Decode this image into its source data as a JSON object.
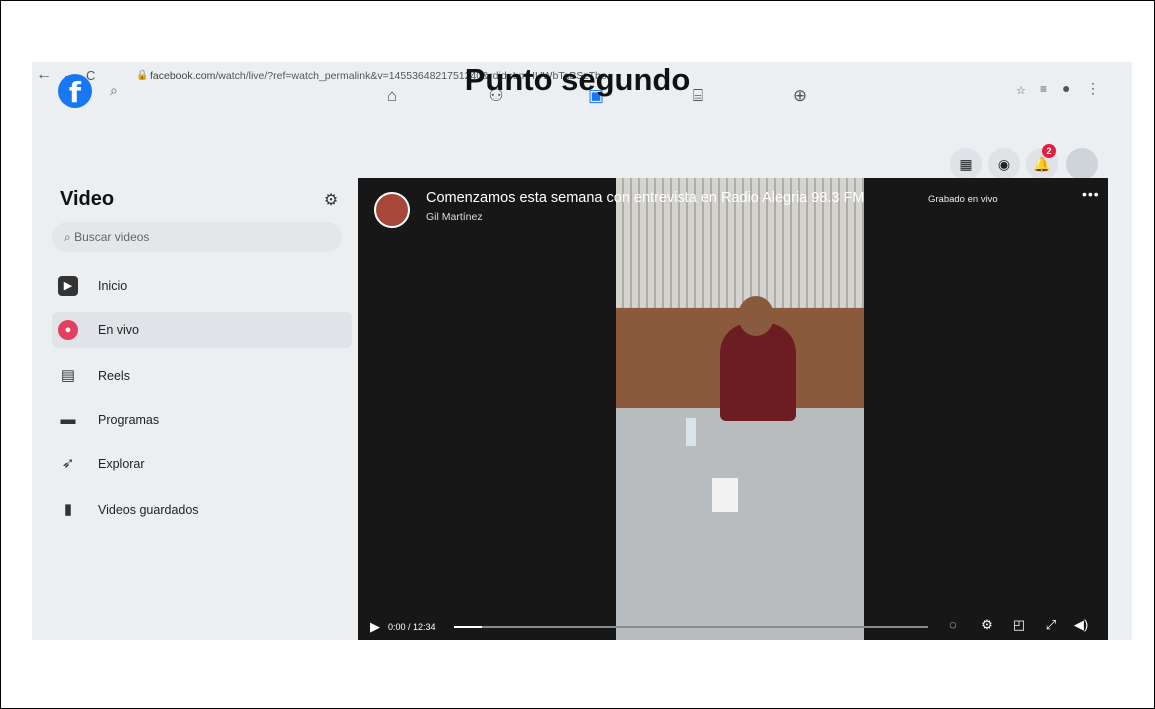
{
  "doc": {
    "title": "Punto segundo"
  },
  "browser": {
    "url_host": "facebook.com",
    "url_path": "/watch/live/?ref=watch_permalink&v=1455364821751240&rdid=LmHUWbTaBSzTbo",
    "back": "←",
    "forward": "→",
    "reload": "C"
  },
  "fb": {
    "logo": "f",
    "nav_tabs": [
      {
        "icon": "home-icon",
        "glyph": "⌂"
      },
      {
        "icon": "friends-icon",
        "glyph": "👥"
      },
      {
        "icon": "watch-icon",
        "glyph": "▶"
      },
      {
        "icon": "marketplace-icon",
        "glyph": "🏪"
      },
      {
        "icon": "gaming-icon",
        "glyph": "🎮"
      }
    ],
    "notification_count": "2"
  },
  "sidebar": {
    "title": "Video",
    "search_placeholder": "Buscar videos",
    "items": [
      {
        "label": "Inicio"
      },
      {
        "label": "En vivo"
      },
      {
        "label": "Reels"
      },
      {
        "label": "Programas"
      },
      {
        "label": "Explorar"
      },
      {
        "label": "Videos guardados"
      }
    ]
  },
  "video": {
    "title": "Comenzamos esta semana con entrevista en Radio Alegria 98.3 FM",
    "tag": "Grabado en vivo",
    "author": "Gil Martínez",
    "time": "0:00 / 12:34",
    "progress": 0.06
  },
  "colors": {
    "accent": "#1877f2",
    "live": "#e4405f",
    "badge": "#e41e3f"
  }
}
